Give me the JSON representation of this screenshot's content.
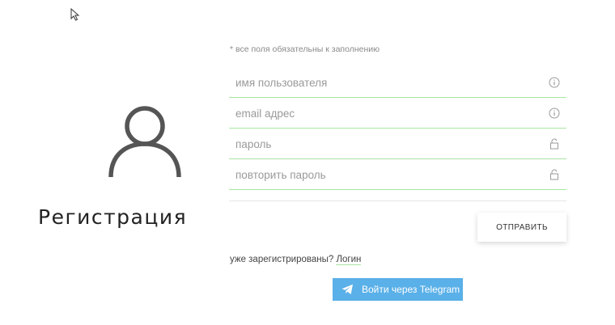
{
  "page": {
    "title": "Регистрация",
    "required_note": "* все поля обязательны к заполнению"
  },
  "form": {
    "fields": [
      {
        "name": "username",
        "value": "",
        "placeholder": "имя пользователя",
        "icon": "info-icon"
      },
      {
        "name": "email",
        "value": "",
        "placeholder": "email адрес",
        "icon": "info-icon"
      },
      {
        "name": "password",
        "value": "",
        "placeholder": "пароль",
        "icon": "lock-icon"
      },
      {
        "name": "password_repeat",
        "value": "",
        "placeholder": "повторить пароль",
        "icon": "lock-icon"
      }
    ],
    "submit_label": "ОТПРАВИТЬ"
  },
  "login": {
    "prompt": "уже зарегистрированы?",
    "link_label": "Логин"
  },
  "telegram": {
    "label": "Войти через Telegram",
    "icon": "telegram-plane-icon"
  },
  "colors": {
    "accent_underline": "#a8e6a2",
    "telegram_blue": "#5ab0e8",
    "avatar": "#555555"
  }
}
